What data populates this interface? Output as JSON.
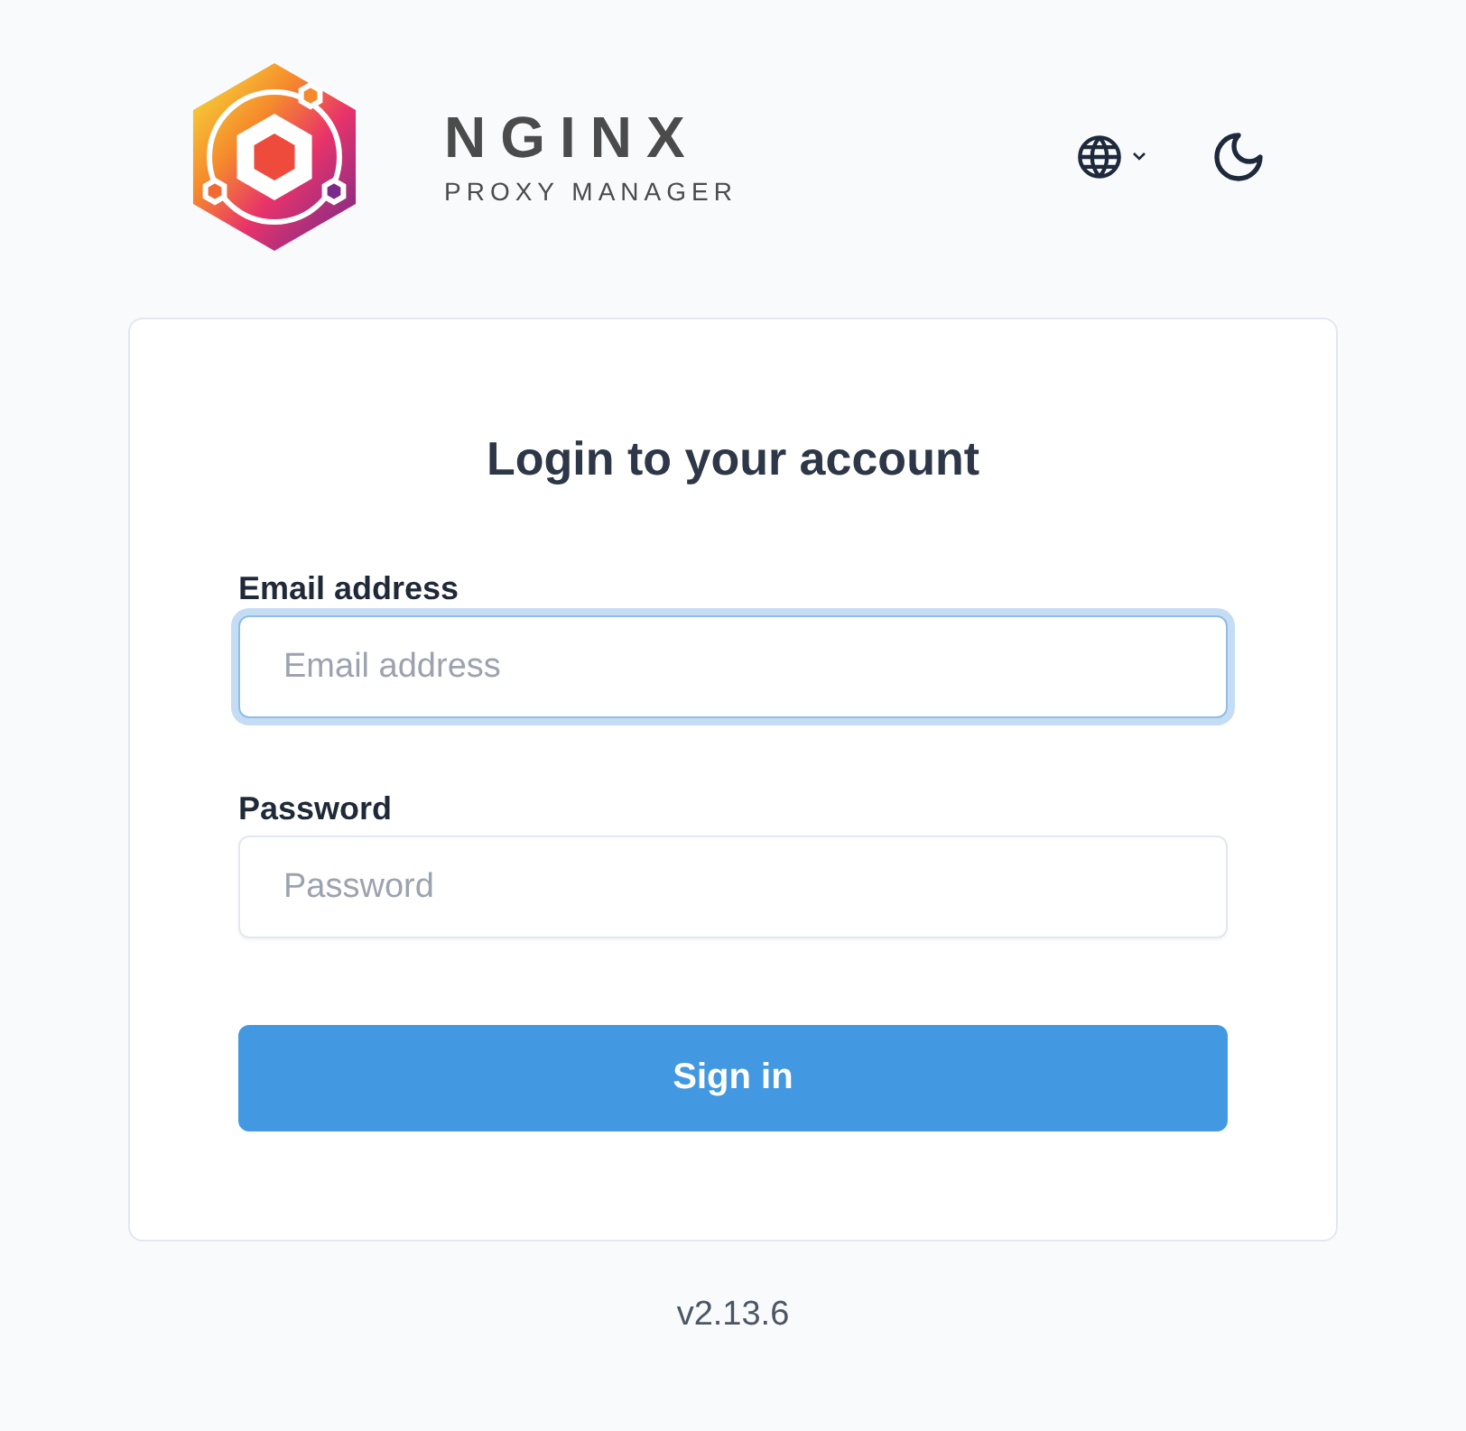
{
  "header": {
    "brand": {
      "title": "NGINX",
      "subtitle": "PROXY MANAGER"
    }
  },
  "login": {
    "title": "Login to your account",
    "fields": [
      {
        "label": "Email address",
        "placeholder": "Email address",
        "focused": true
      },
      {
        "label": "Password",
        "placeholder": "Password",
        "focused": false
      }
    ],
    "submit": "Sign in"
  },
  "footer": {
    "version": "v2.13.6"
  }
}
